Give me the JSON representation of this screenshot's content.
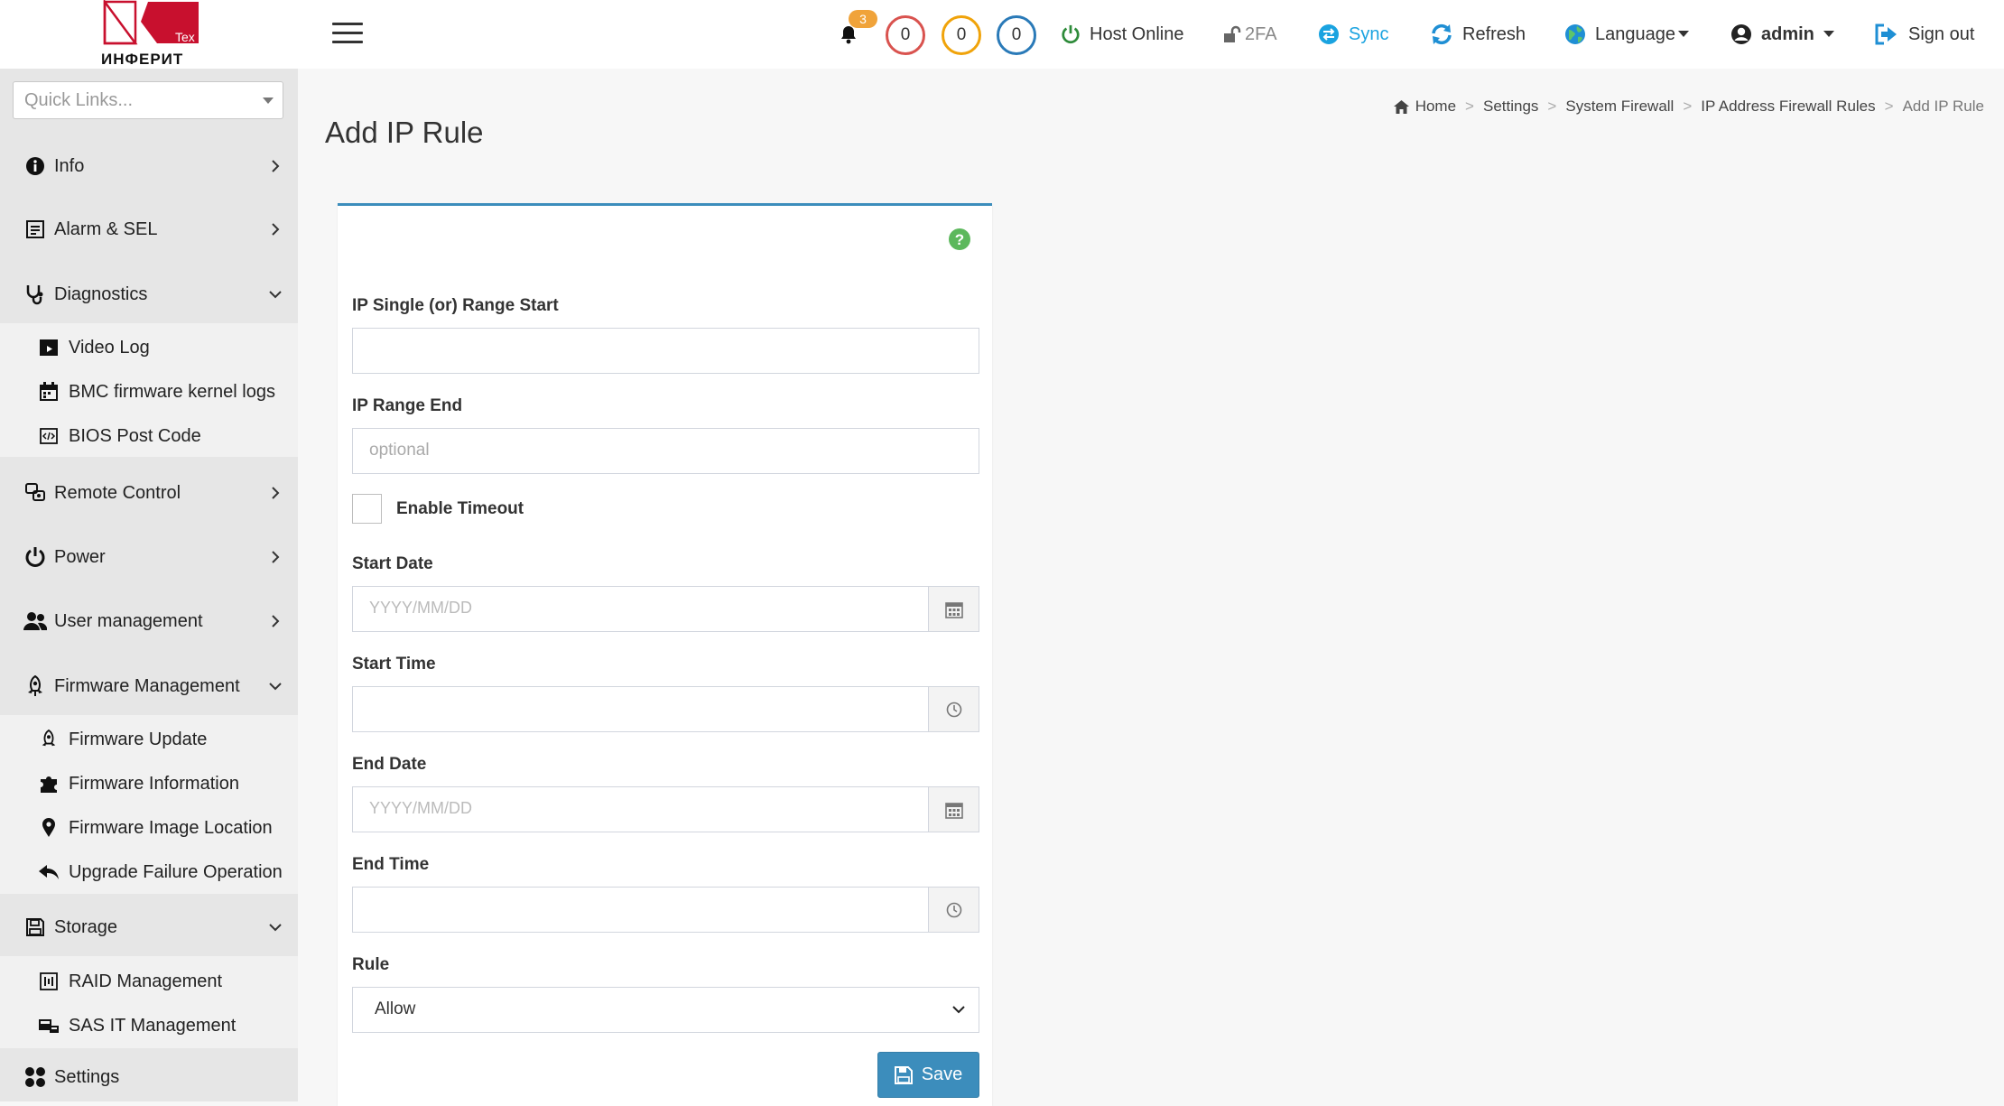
{
  "brand": {
    "logo_badge": "Tex",
    "logo_text": "ИНФЕРИТ"
  },
  "quick_links": {
    "placeholder": "Quick Links..."
  },
  "sidebar": {
    "items": [
      {
        "label": "Info",
        "icon": "info-circle-icon"
      },
      {
        "label": "Alarm & SEL",
        "icon": "alarm-log-icon"
      },
      {
        "label": "Diagnostics",
        "icon": "stethoscope-icon",
        "expanded": true,
        "children": [
          {
            "label": "Video Log",
            "icon": "video-icon"
          },
          {
            "label": "BMC firmware kernel logs",
            "icon": "calendar-icon"
          },
          {
            "label": "BIOS Post Code",
            "icon": "code-icon"
          }
        ]
      },
      {
        "label": "Remote Control",
        "icon": "remote-control-icon"
      },
      {
        "label": "Power",
        "icon": "power-icon"
      },
      {
        "label": "User management",
        "icon": "users-icon"
      },
      {
        "label": "Firmware Management",
        "icon": "rocket-icon",
        "expanded": true,
        "children": [
          {
            "label": "Firmware Update",
            "icon": "rocket-icon"
          },
          {
            "label": "Firmware Information",
            "icon": "puzzle-icon"
          },
          {
            "label": "Firmware Image Location",
            "icon": "map-pin-icon"
          },
          {
            "label": "Upgrade Failure Operation",
            "icon": "reply-icon"
          }
        ]
      },
      {
        "label": "Storage",
        "icon": "floppy-icon",
        "expanded": true,
        "children": [
          {
            "label": "RAID Management",
            "icon": "raid-icon"
          },
          {
            "label": "SAS IT Management",
            "icon": "sas-icon"
          }
        ]
      },
      {
        "label": "Settings",
        "icon": "settings-grid-icon"
      }
    ]
  },
  "header": {
    "notification_count": "3",
    "counters": [
      {
        "value": "0",
        "color": "#d9534f"
      },
      {
        "value": "0",
        "color": "#f0a30a"
      },
      {
        "value": "0",
        "color": "#2a7ab8"
      }
    ],
    "host_status": "Host Online",
    "twofa": "2FA",
    "sync": "Sync",
    "refresh": "Refresh",
    "language": "Language",
    "user": "admin",
    "signout": "Sign out"
  },
  "page": {
    "title": "Add IP Rule",
    "breadcrumb": [
      "Home",
      "Settings",
      "System Firewall",
      "IP Address Firewall Rules",
      "Add IP Rule"
    ]
  },
  "form": {
    "ip_start_label": "IP Single (or) Range Start",
    "ip_start_value": "",
    "ip_end_label": "IP Range End",
    "ip_end_placeholder": "optional",
    "timeout_label": "Enable Timeout",
    "timeout_checked": false,
    "start_date_label": "Start Date",
    "start_date_placeholder": "YYYY/MM/DD",
    "start_time_label": "Start Time",
    "end_date_label": "End Date",
    "end_date_placeholder": "YYYY/MM/DD",
    "end_time_label": "End Time",
    "rule_label": "Rule",
    "rule_value": "Allow",
    "save_label": "Save"
  },
  "colors": {
    "accent": "#3c8dbc",
    "host_online": "#2e8b3a",
    "sync": "#1aa3e0",
    "help": "#5cb85c"
  }
}
